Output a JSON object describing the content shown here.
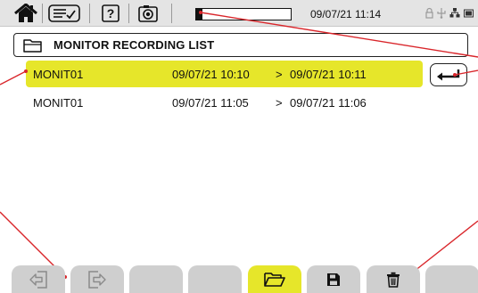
{
  "toolbar": {
    "home_icon": "home-icon",
    "list_icon": "checklist-icon",
    "help_label": "?",
    "camera_icon": "camera-icon",
    "progress_fraction": 0.07,
    "datetime": "09/07/21 11:14",
    "status_icons": [
      "lock-icon",
      "usb-icon",
      "network-icon",
      "battery-icon"
    ]
  },
  "panel": {
    "title": "MONITOR RECORDING LIST",
    "title_icon": "folder-icon"
  },
  "recordings": [
    {
      "name": "MONIT01",
      "start": "09/07/21 10:10",
      "separator": ">",
      "end": "09/07/21 10:11",
      "selected": true
    },
    {
      "name": "MONIT01",
      "start": "09/07/21 11:05",
      "separator": ">",
      "end": "09/07/21 11:06",
      "selected": false
    }
  ],
  "enter_icon": "enter-return-icon",
  "tabs": [
    {
      "icon": "exit-left-icon"
    },
    {
      "icon": "exit-right-icon"
    },
    {
      "icon": ""
    },
    {
      "icon": ""
    },
    {
      "icon": "open-folder-icon",
      "active": true
    },
    {
      "icon": "save-icon"
    },
    {
      "icon": "trash-icon"
    },
    {
      "icon": ""
    }
  ],
  "colors": {
    "accent_yellow": "#e6e62a",
    "toolbar_bg": "#e4e4e4",
    "tab_bg": "#cfcfcf",
    "callout_red": "#d9262b"
  }
}
